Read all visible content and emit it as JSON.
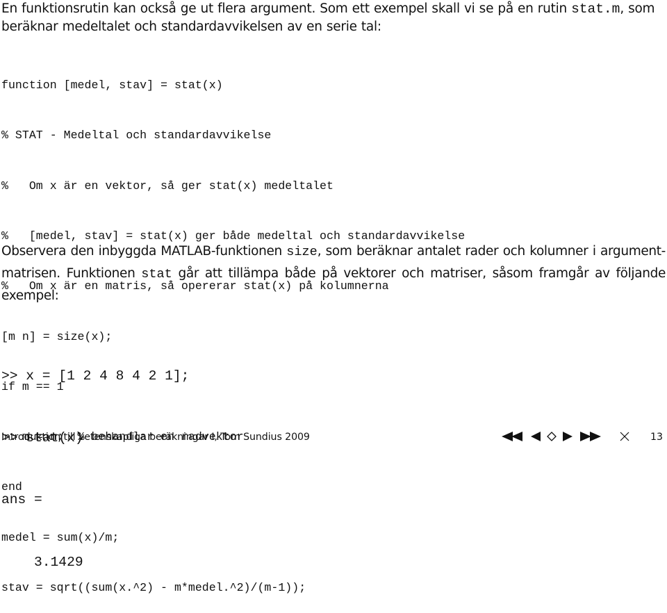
{
  "intro": {
    "text_before": "En funktionsrutin kan också ge ut flera argument. Som ett exempel skall vi se på en rutin ",
    "code_name": "stat.m",
    "text_after": ", som beräknar medeltalet och standardavvikelsen av en serie tal:"
  },
  "code": {
    "lines": [
      "function [medel, stav] = stat(x)",
      "% STAT - Medeltal och standardavvikelse",
      "%   Om x är en vektor, så ger stat(x) medeltalet",
      "%   [medel, stav] = stat(x) ger både medeltal och standardavvikelse",
      "%   Om x är en matris, så opererar stat(x) på kolumnerna",
      "[m n] = size(x);",
      "if m == 1",
      "   m = n;  % behandlar en radvektor",
      "end",
      "medel = sum(x)/m;",
      "stav = sqrt((sum(x.^2) - m*medel.^2)/(m-1));"
    ]
  },
  "observe": {
    "part1": "Observera den inbyggda MATLAB-funktionen ",
    "code1": "size",
    "part2": ", som beräknar antalet rader och kolumner i argument-matrisen. Funktionen ",
    "code2": "stat",
    "part3": " går att tillämpa både på vektorer och matriser, såsom framgår av följande exempel:"
  },
  "session": {
    "lines": [
      ">> x = [1 2 4 8 4 2 1];",
      ">> stat(x)",
      "ans =",
      "    3.1429"
    ]
  },
  "footer": {
    "title": "Introduktion till vetenskapliga beräkningar I, Tom Sundius 2009",
    "page_number": "13",
    "nav": [
      {
        "name": "first-page-icon",
        "label": "first"
      },
      {
        "name": "prev-page-icon",
        "label": "previous"
      },
      {
        "name": "back-icon",
        "label": "back"
      },
      {
        "name": "next-page-icon",
        "label": "next"
      },
      {
        "name": "last-page-icon",
        "label": "last"
      },
      {
        "name": "close-icon",
        "label": "close"
      }
    ]
  }
}
